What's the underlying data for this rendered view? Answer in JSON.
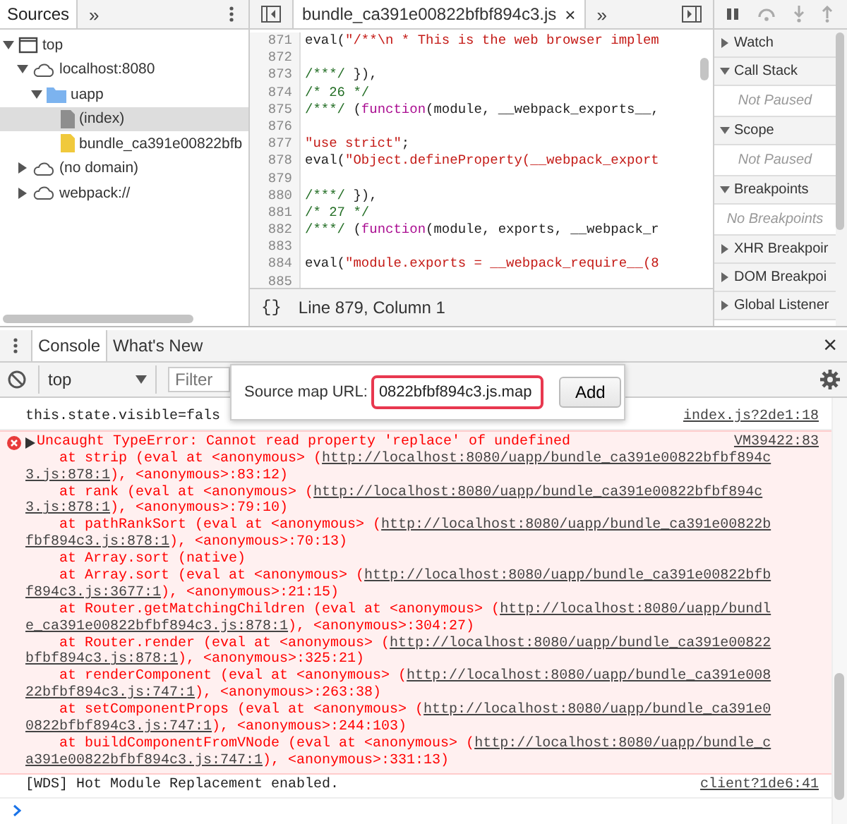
{
  "navigator": {
    "tabs": [
      {
        "label": "Sources",
        "selected": true
      }
    ],
    "more": "»",
    "tree": [
      {
        "label": "top",
        "kind": "frame",
        "expanded": true,
        "selected": false,
        "children": [
          {
            "label": "localhost:8080",
            "kind": "domain",
            "expanded": true,
            "selected": false,
            "children": [
              {
                "label": "uapp",
                "kind": "folder",
                "expanded": true,
                "selected": false,
                "children": [
                  {
                    "label": "(index)",
                    "kind": "document",
                    "selected": true
                  },
                  {
                    "label": "bundle_ca391e00822bfb",
                    "kind": "script",
                    "selected": false
                  }
                ]
              }
            ]
          },
          {
            "label": "(no domain)",
            "kind": "domain",
            "expanded": false,
            "selected": false
          },
          {
            "label": "webpack://",
            "kind": "domain",
            "expanded": false,
            "selected": false
          }
        ]
      }
    ]
  },
  "editor": {
    "tab": {
      "label": "bundle_ca391e00822bfbf894c3.js",
      "close": "×"
    },
    "more": "»",
    "lines": [
      {
        "num": "871",
        "tokens": [
          {
            "kind": "plain",
            "text": "eval("
          },
          {
            "kind": "string",
            "text": "\"/**\\n * This is the web browser implem"
          }
        ]
      },
      {
        "num": "872"
      },
      {
        "num": "873",
        "tokens": [
          {
            "kind": "comment",
            "text": "/***/"
          },
          {
            "kind": "plain",
            "text": " }),"
          }
        ]
      },
      {
        "num": "874",
        "tokens": [
          {
            "kind": "comment",
            "text": "/* 26 */"
          }
        ]
      },
      {
        "num": "875",
        "tokens": [
          {
            "kind": "comment",
            "text": "/***/"
          },
          {
            "kind": "plain",
            "text": " ("
          },
          {
            "kind": "keyword",
            "text": "function"
          },
          {
            "kind": "plain",
            "text": "(module, __webpack_exports__,"
          }
        ]
      },
      {
        "num": "876"
      },
      {
        "num": "877",
        "tokens": [
          {
            "kind": "string",
            "text": "\"use strict\""
          },
          {
            "kind": "plain",
            "text": ";"
          }
        ]
      },
      {
        "num": "878",
        "tokens": [
          {
            "kind": "plain",
            "text": "eval("
          },
          {
            "kind": "string",
            "text": "\"Object.defineProperty(__webpack_export"
          }
        ]
      },
      {
        "num": "879"
      },
      {
        "num": "880",
        "tokens": [
          {
            "kind": "comment",
            "text": "/***/"
          },
          {
            "kind": "plain",
            "text": " }),"
          }
        ]
      },
      {
        "num": "881",
        "tokens": [
          {
            "kind": "comment",
            "text": "/* 27 */"
          }
        ]
      },
      {
        "num": "882",
        "tokens": [
          {
            "kind": "comment",
            "text": "/***/"
          },
          {
            "kind": "plain",
            "text": " ("
          },
          {
            "kind": "keyword",
            "text": "function"
          },
          {
            "kind": "plain",
            "text": "(module, exports, __webpack_r"
          }
        ]
      },
      {
        "num": "883"
      },
      {
        "num": "884",
        "tokens": [
          {
            "kind": "plain",
            "text": "eval("
          },
          {
            "kind": "string",
            "text": "\"module.exports = __webpack_require__(8"
          }
        ]
      },
      {
        "num": "885"
      }
    ],
    "pretty_print": "{}",
    "status": "Line 879, Column 1"
  },
  "debugger": {
    "sections": [
      {
        "title": "Watch",
        "expanded": false
      },
      {
        "title": "Call Stack",
        "expanded": true,
        "content": "Not Paused"
      },
      {
        "title": "Scope",
        "expanded": true,
        "content": "Not Paused"
      },
      {
        "title": "Breakpoints",
        "expanded": true,
        "content": "No Breakpoints"
      },
      {
        "title": "XHR Breakpoir",
        "expanded": false
      },
      {
        "title": "DOM Breakpoi",
        "expanded": false
      },
      {
        "title": "Global Listener",
        "expanded": false
      }
    ]
  },
  "drawer": {
    "tabs": [
      {
        "label": "Console",
        "selected": true
      },
      {
        "label": "What's New",
        "selected": false
      }
    ],
    "close": "×"
  },
  "console": {
    "context": "top",
    "filter": {
      "placeholder": "Filter"
    },
    "popover": {
      "label": "Source map URL:",
      "value": "0822bfbf894c3.js.map",
      "button": "Add"
    },
    "messages": [
      {
        "kind": "log",
        "lines": [
          [
            {
              "text": "this.state.visible=fals",
              "link": false
            }
          ]
        ],
        "source": "index.js?2de1:18"
      },
      {
        "kind": "error",
        "expanded": false,
        "source": "VM39422:83",
        "lines": [
          [
            {
              "text": "Uncaught TypeError: Cannot read property 'replace' of undefined",
              "link": false
            }
          ],
          [
            {
              "text": "    at strip (eval at <anonymous> (",
              "link": false
            },
            {
              "text": "http://localhost:8080/uapp/bundle_ca391e00822bfbf894c",
              "link": true
            }
          ],
          [
            {
              "text": "3.js:878:1",
              "link": true
            },
            {
              "text": "), <anonymous>:83:12)",
              "link": false
            }
          ],
          [
            {
              "text": "    at rank (eval at <anonymous> (",
              "link": false
            },
            {
              "text": "http://localhost:8080/uapp/bundle_ca391e00822bfbf894c",
              "link": true
            }
          ],
          [
            {
              "text": "3.js:878:1",
              "link": true
            },
            {
              "text": "), <anonymous>:79:10)",
              "link": false
            }
          ],
          [
            {
              "text": "    at pathRankSort (eval at <anonymous> (",
              "link": false
            },
            {
              "text": "http://localhost:8080/uapp/bundle_ca391e00822b",
              "link": true
            }
          ],
          [
            {
              "text": "fbf894c3.js:878:1",
              "link": true
            },
            {
              "text": "), <anonymous>:70:13)",
              "link": false
            }
          ],
          [
            {
              "text": "    at Array.sort (native)",
              "link": false
            }
          ],
          [
            {
              "text": "    at Array.sort (eval at <anonymous> (",
              "link": false
            },
            {
              "text": "http://localhost:8080/uapp/bundle_ca391e00822bfb",
              "link": true
            }
          ],
          [
            {
              "text": "f894c3.js:3677:1",
              "link": true
            },
            {
              "text": "), <anonymous>:21:15)",
              "link": false
            }
          ],
          [
            {
              "text": "    at Router.getMatchingChildren (eval at <anonymous> (",
              "link": false
            },
            {
              "text": "http://localhost:8080/uapp/bundl",
              "link": true
            }
          ],
          [
            {
              "text": "e_ca391e00822bfbf894c3.js:878:1",
              "link": true
            },
            {
              "text": "), <anonymous>:304:27)",
              "link": false
            }
          ],
          [
            {
              "text": "    at Router.render (eval at <anonymous> (",
              "link": false
            },
            {
              "text": "http://localhost:8080/uapp/bundle_ca391e00822",
              "link": true
            }
          ],
          [
            {
              "text": "bfbf894c3.js:878:1",
              "link": true
            },
            {
              "text": "), <anonymous>:325:21)",
              "link": false
            }
          ],
          [
            {
              "text": "    at renderComponent (eval at <anonymous> (",
              "link": false
            },
            {
              "text": "http://localhost:8080/uapp/bundle_ca391e008",
              "link": true
            }
          ],
          [
            {
              "text": "22bfbf894c3.js:747:1",
              "link": true
            },
            {
              "text": "), <anonymous>:263:38)",
              "link": false
            }
          ],
          [
            {
              "text": "    at setComponentProps (eval at <anonymous> (",
              "link": false
            },
            {
              "text": "http://localhost:8080/uapp/bundle_ca391e0",
              "link": true
            }
          ],
          [
            {
              "text": "0822bfbf894c3.js:747:1",
              "link": true
            },
            {
              "text": "), <anonymous>:244:103)",
              "link": false
            }
          ],
          [
            {
              "text": "    at buildComponentFromVNode (eval at <anonymous> (",
              "link": false
            },
            {
              "text": "http://localhost:8080/uapp/bundle_c",
              "link": true
            }
          ],
          [
            {
              "text": "a391e00822bfbf894c3.js:747:1",
              "link": true
            },
            {
              "text": "), <anonymous>:331:13)",
              "link": false
            }
          ]
        ]
      },
      {
        "kind": "log",
        "lines": [
          [
            {
              "text": "[WDS] Hot Module Replacement enabled.",
              "link": false
            }
          ]
        ],
        "source": "client?1de6:41"
      }
    ]
  }
}
